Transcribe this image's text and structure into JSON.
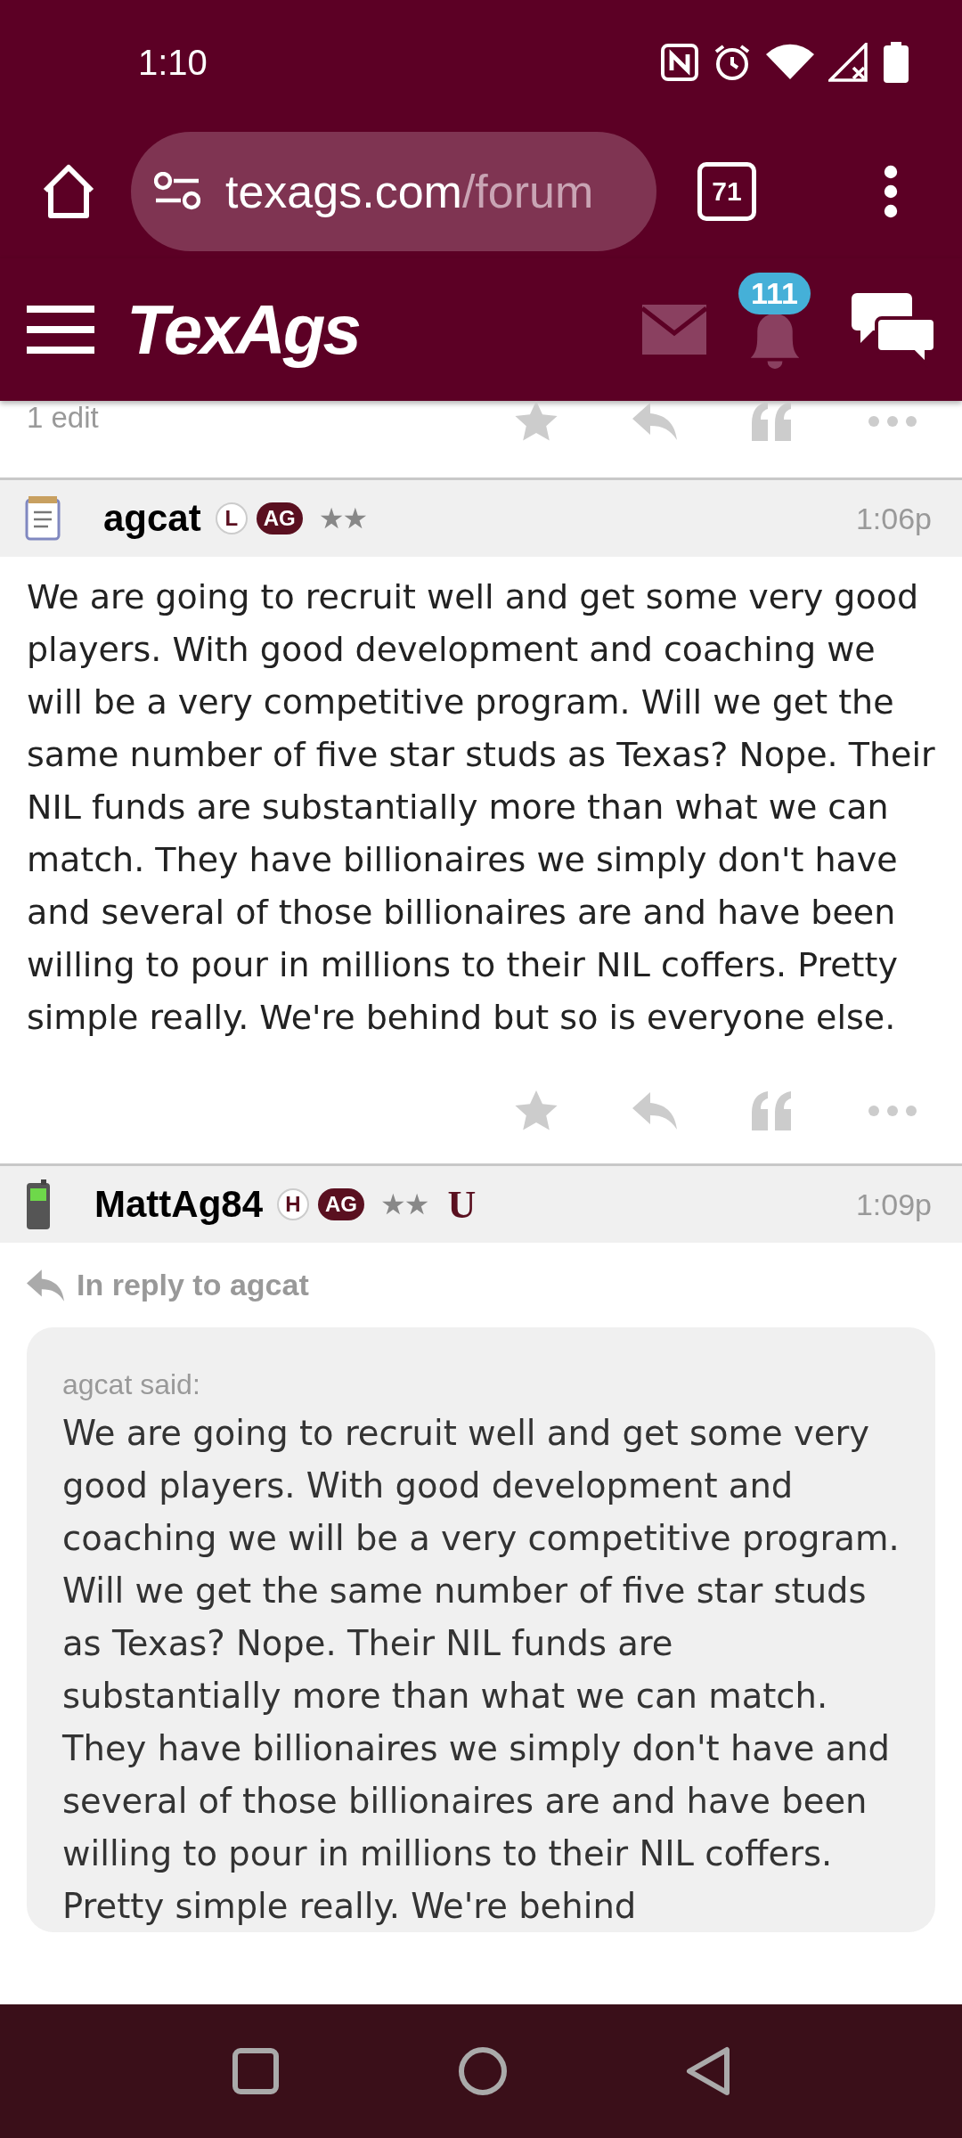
{
  "status_bar": {
    "time": "1:10"
  },
  "browser": {
    "url_host": "texags.com",
    "url_path": "/forum",
    "tab_count": "71"
  },
  "site_header": {
    "logo": "TexAgs",
    "notification_count": "111"
  },
  "previous_post": {
    "edit_note": "1 edit"
  },
  "posts": [
    {
      "author": "agcat",
      "kind": "notepad",
      "badges": [
        {
          "label": "L",
          "kind": "outline"
        },
        {
          "label": "AG",
          "kind": "filled"
        }
      ],
      "star_mark": "★★",
      "time": "1:06p",
      "body": "We are going to recruit well and get some very good players. With good development and coaching we will be a very competitive program. Will we get the same number of five star studs as Texas? Nope. Their NIL funds are substantially more than what we can match. They have billionaires we simply don't have and several of those billionaires are and have been willing to pour in millions to their NIL coffers. Pretty simple really. We're behind but so is everyone else."
    },
    {
      "author": "MattAg84",
      "kind": "phone",
      "badges": [
        {
          "label": "H",
          "kind": "outline"
        },
        {
          "label": "AG",
          "kind": "filled"
        }
      ],
      "star_mark": "★★",
      "extra_mark": "U",
      "time": "1:09p",
      "reply_to": "In reply to agcat",
      "quote": {
        "attribution": "agcat said:",
        "text": "We are going to recruit well and get some very good players. With good development and coaching we will be a very competitive program. Will we get the same number of five star studs as Texas? Nope. Their NIL funds are substantially more than what we can match. They have billionaires we simply don't have and several of those billionaires are and have been willing to pour in millions to their NIL coffers. Pretty simple really. We're behind"
      }
    }
  ]
}
